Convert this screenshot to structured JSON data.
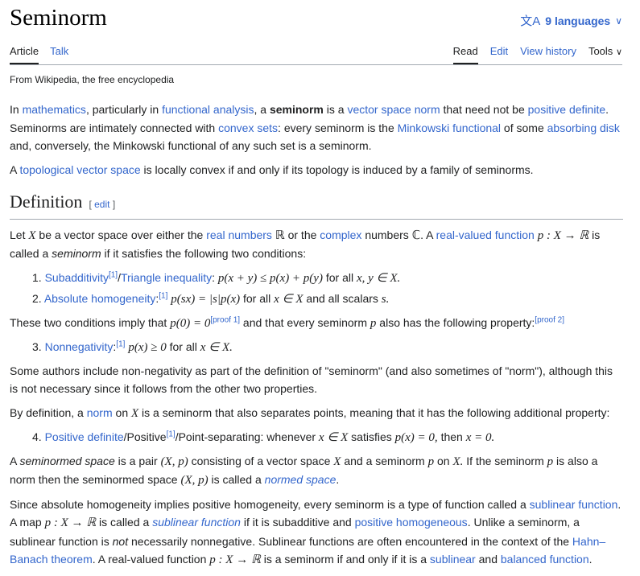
{
  "header": {
    "title": "Seminorm",
    "languages_icon": "translate-icon",
    "languages_label": "9 languages",
    "chevron": "chevron-down-icon"
  },
  "tabs": {
    "article": "Article",
    "talk": "Talk",
    "read": "Read",
    "edit": "Edit",
    "view_history": "View history",
    "tools": "Tools"
  },
  "tagline": "From Wikipedia, the free encyclopedia",
  "intro": {
    "p1": {
      "t1": "In ",
      "l_mathematics": "mathematics",
      "t2": ", particularly in ",
      "l_functional_analysis": "functional analysis",
      "t3": ", a ",
      "bold": "seminorm",
      "t4": " is a ",
      "l_vector_space_norm": "vector space norm",
      "t5": " that need not be ",
      "l_positive_definite": "positive definite",
      "t6": ". Seminorms are intimately connected with ",
      "l_convex_sets": "convex sets",
      "t7": ": every seminorm is the ",
      "l_minkowski": "Minkowski functional",
      "t8": " of some ",
      "l_absorbing": "absorbing disk",
      "t9": " and, conversely, the Minkowski functional of any such set is a seminorm."
    },
    "p2": {
      "t1": "A ",
      "l_tvs": "topological vector space",
      "t2": " is locally convex if and only if its topology is induced by a family of seminorms."
    }
  },
  "definition": {
    "heading": "Definition",
    "edit_open": "[",
    "edit_label": "edit",
    "edit_close": "]",
    "p1": {
      "t1": "Let ",
      "X": "X",
      "t2": " be a vector space over either the ",
      "l_real": "real numbers",
      "R": "ℝ",
      "t3": " or the ",
      "l_complex": "complex",
      "t4": " numbers ",
      "C": "ℂ",
      "t5": ". A ",
      "l_real_valued": "real-valued function",
      "map": "p : X → ℝ",
      "t6": " is called a ",
      "em": "seminorm",
      "t7": " if it satisfies the following two conditions:"
    },
    "list1": [
      {
        "num": "1.",
        "link1": "Subadditivity",
        "sup": "[1]",
        "sep": "/",
        "link2": "Triangle inequality",
        "colon": ":",
        "math": "p(x + y) ≤ p(x) + p(y)",
        "text": " for all ",
        "math2": "x, y ∈ X."
      },
      {
        "num": "2.",
        "link1": "Absolute homogeneity",
        "colon": ":",
        "sup": "[1]",
        "math": "p(sx) = |s|p(x)",
        "text": " for all ",
        "math2": "x ∈ X",
        "text2": " and all scalars ",
        "math3": "s."
      }
    ],
    "p2": {
      "t1": "These two conditions imply that ",
      "math": "p(0) = 0",
      "sup1": "[proof 1]",
      "t2": " and that every seminorm ",
      "p": "p",
      "t3": " also has the following property:",
      "sup2": "[proof 2]"
    },
    "item3": {
      "num": "3.",
      "link": "Nonnegativity",
      "colon": ":",
      "sup": "[1]",
      "math": "p(x) ≥ 0",
      "text": " for all ",
      "math2": "x ∈ X."
    },
    "p3": "Some authors include non-negativity as part of the definition of \"seminorm\" (and also sometimes of \"norm\"), although this is not necessary since it follows from the other two properties.",
    "p4": {
      "t1": "By definition, a ",
      "l_norm": "norm",
      "t2": " on ",
      "X": "X",
      "t3": " is a seminorm that also separates points, meaning that it has the following additional property:"
    },
    "item4": {
      "num": "4.",
      "link": "Positive definite",
      "t1": "/Positive",
      "sup": "[1]",
      "t2": "/Point-separating: whenever ",
      "math1": "x ∈ X",
      "t3": " satisfies ",
      "math2": "p(x) = 0,",
      "t4": " then ",
      "math3": "x = 0."
    },
    "p5": {
      "t1": "A ",
      "em1": "seminormed space",
      "t2": " is a pair ",
      "m1": "(X, p)",
      "t3": " consisting of a vector space ",
      "m2": "X",
      "t4": " and a seminorm ",
      "m3": "p",
      "t5": " on ",
      "m4": "X.",
      "t6": " If the seminorm ",
      "m5": "p",
      "t7": " is also a norm then the seminormed space ",
      "m6": "(X, p)",
      "t8": " is called a ",
      "l_normed": "normed space",
      "t9": "."
    },
    "p6": {
      "t1": "Since absolute homogeneity implies positive homogeneity, every seminorm is a type of function called a ",
      "l_sublinear": "sublinear function",
      "t2": ". A map ",
      "m1": "p : X → ℝ",
      "t3": " is called a ",
      "l_sublinear_em": "sublinear function",
      "t4": " if it is subadditive and ",
      "l_pos_hom": "positive homogeneous",
      "t5": ". Unlike a seminorm, a sublinear function is ",
      "em": "not",
      "t6": " necessarily nonnegative. Sublinear functions are often encountered in the context of the ",
      "l_hahn": "Hahn–Banach theorem",
      "t7": ". A real-valued function ",
      "m2": "p : X → ℝ",
      "t8": " is a seminorm if and only if it is a ",
      "l_sublinear2": "sublinear",
      "t9": " and ",
      "l_balanced": "balanced function",
      "t10": "."
    }
  }
}
